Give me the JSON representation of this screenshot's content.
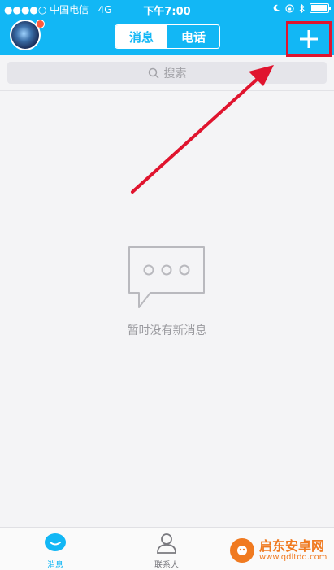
{
  "status_bar": {
    "carrier": "●●●●○ 中国电信",
    "network": "4G",
    "time": "下午7:00"
  },
  "header": {
    "tabs": [
      {
        "label": "消息",
        "active": true
      },
      {
        "label": "电话",
        "active": false
      }
    ],
    "plus_icon": "plus-icon",
    "highlight_color": "#e0142e"
  },
  "search": {
    "placeholder": "搜索"
  },
  "empty_state": {
    "text": "暂时没有新消息"
  },
  "tabbar": {
    "items": [
      {
        "label": "消息",
        "active": true
      },
      {
        "label": "联系人",
        "active": false
      }
    ]
  },
  "watermark": {
    "title": "启东安卓网",
    "url": "www.qdltdq.com"
  },
  "colors": {
    "brand": "#12b7f5",
    "annotation": "#e0142e"
  }
}
